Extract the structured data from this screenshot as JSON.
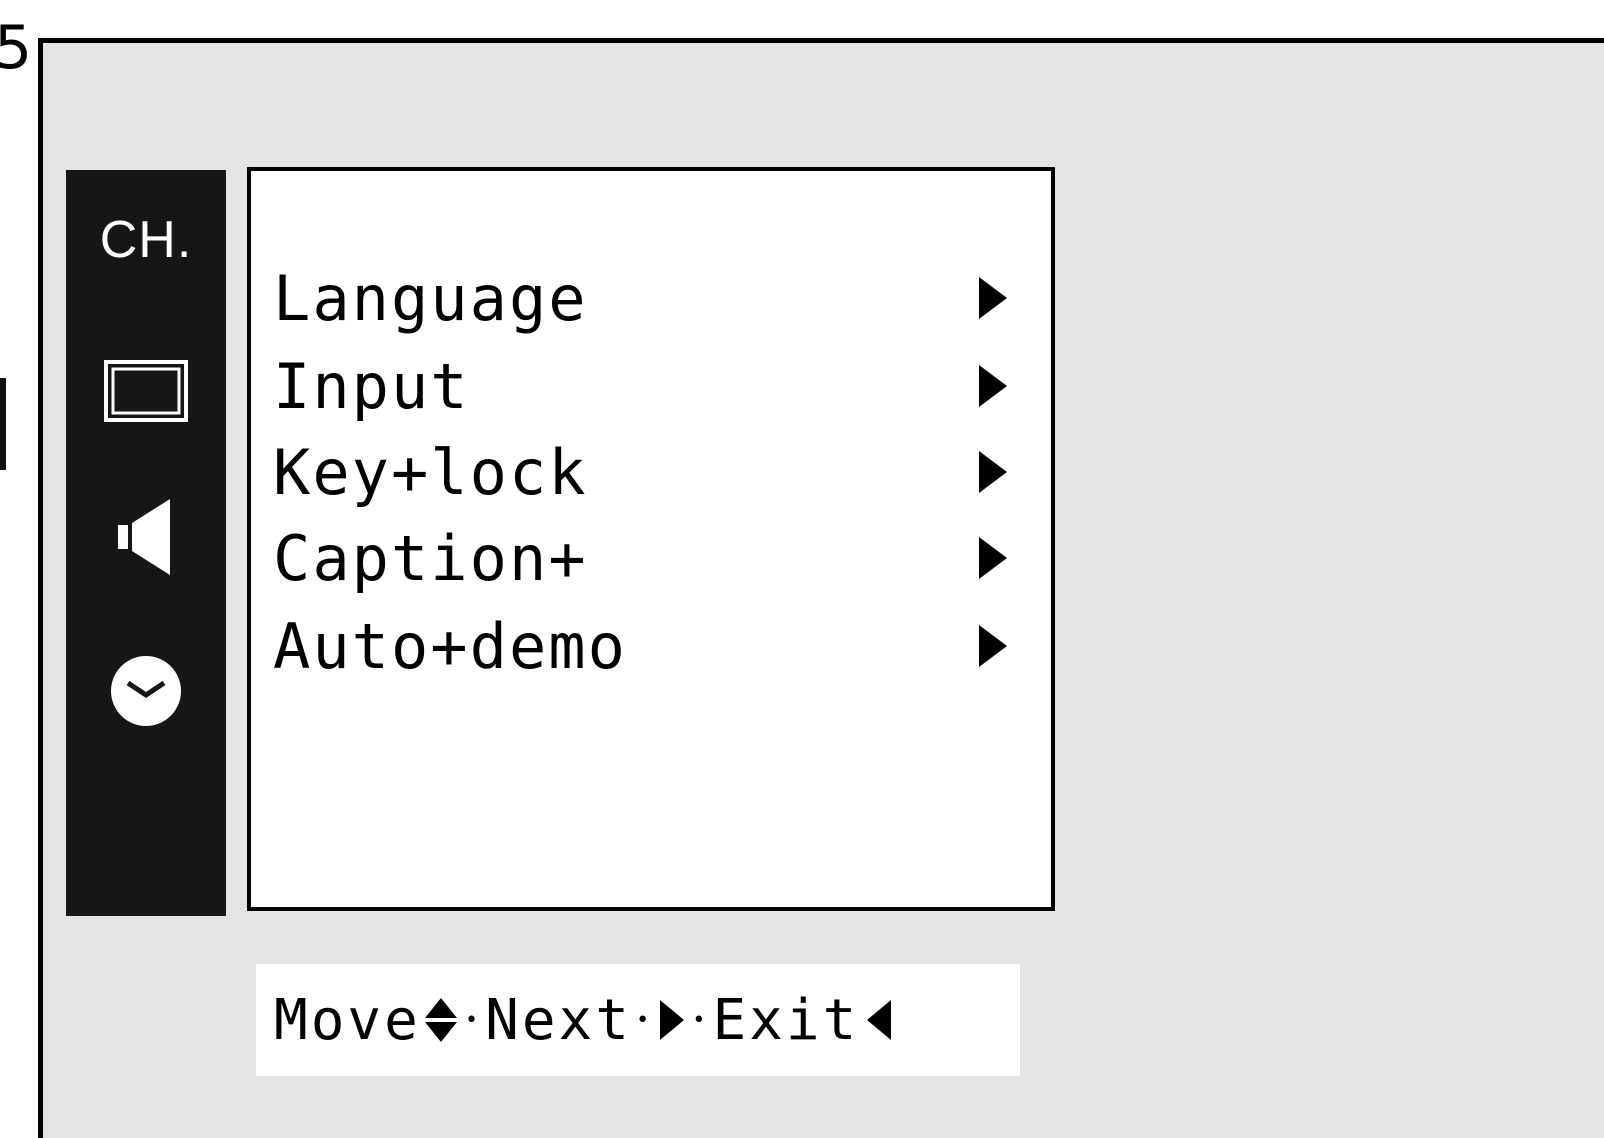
{
  "sidebar": {
    "items": [
      {
        "label": "CH.",
        "name": "channel"
      },
      {
        "icon": "picture-icon"
      },
      {
        "icon": "speaker-icon"
      },
      {
        "icon": "clock-icon"
      }
    ]
  },
  "menu": {
    "items": [
      {
        "label": "Language"
      },
      {
        "label": "Input"
      },
      {
        "label": "Key+lock"
      },
      {
        "label": "Caption+"
      },
      {
        "label": "Auto+demo"
      }
    ]
  },
  "help": {
    "move": "Move",
    "next": "Next",
    "exit": "Exit"
  },
  "colors": {
    "screen_bg": "#e4e4e4",
    "sidebar_bg": "#161616",
    "menu_bg": "#ffffff"
  }
}
